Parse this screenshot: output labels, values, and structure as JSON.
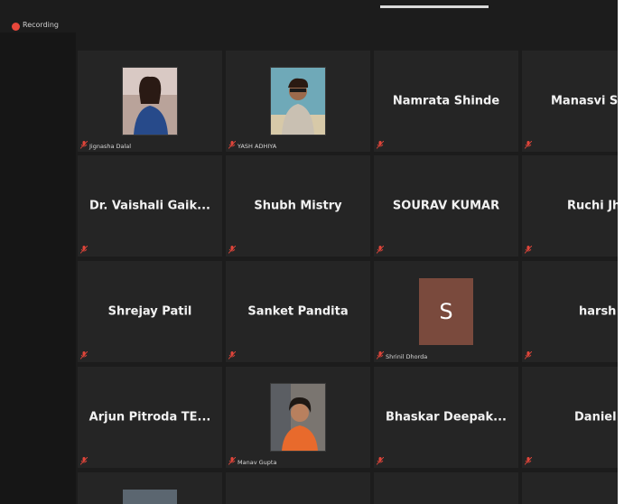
{
  "recording_label": "Recording",
  "tiles": [
    {
      "name": "",
      "label": "Jignasha Dalal"
    },
    {
      "name": "",
      "label": "YASH ADHIYA"
    },
    {
      "name": "Namrata Shinde"
    },
    {
      "name": "Manasvi Sab"
    },
    {
      "name": "Dr. Vaishali Gaik..."
    },
    {
      "name": "Shubh Mistry"
    },
    {
      "name": "SOURAV KUMAR"
    },
    {
      "name": "Ruchi Jha"
    },
    {
      "name": "Shrejay Patil"
    },
    {
      "name": "Sanket Pandita"
    },
    {
      "name": "",
      "avatar_letter": "S",
      "label": "Shrinil Dhorda"
    },
    {
      "name": "harsh"
    },
    {
      "name": "Arjun Pitroda TE..."
    },
    {
      "name": "",
      "label": "Manav Gupta"
    },
    {
      "name": "Bhaskar Deepak..."
    },
    {
      "name": "Daniel"
    }
  ],
  "colors": {
    "background": "#1c1c1c",
    "tile": "#252525",
    "muted_icon": "#e0453a",
    "avatar_s": "#7a4a3d",
    "recording_dot": "#e8473b"
  }
}
